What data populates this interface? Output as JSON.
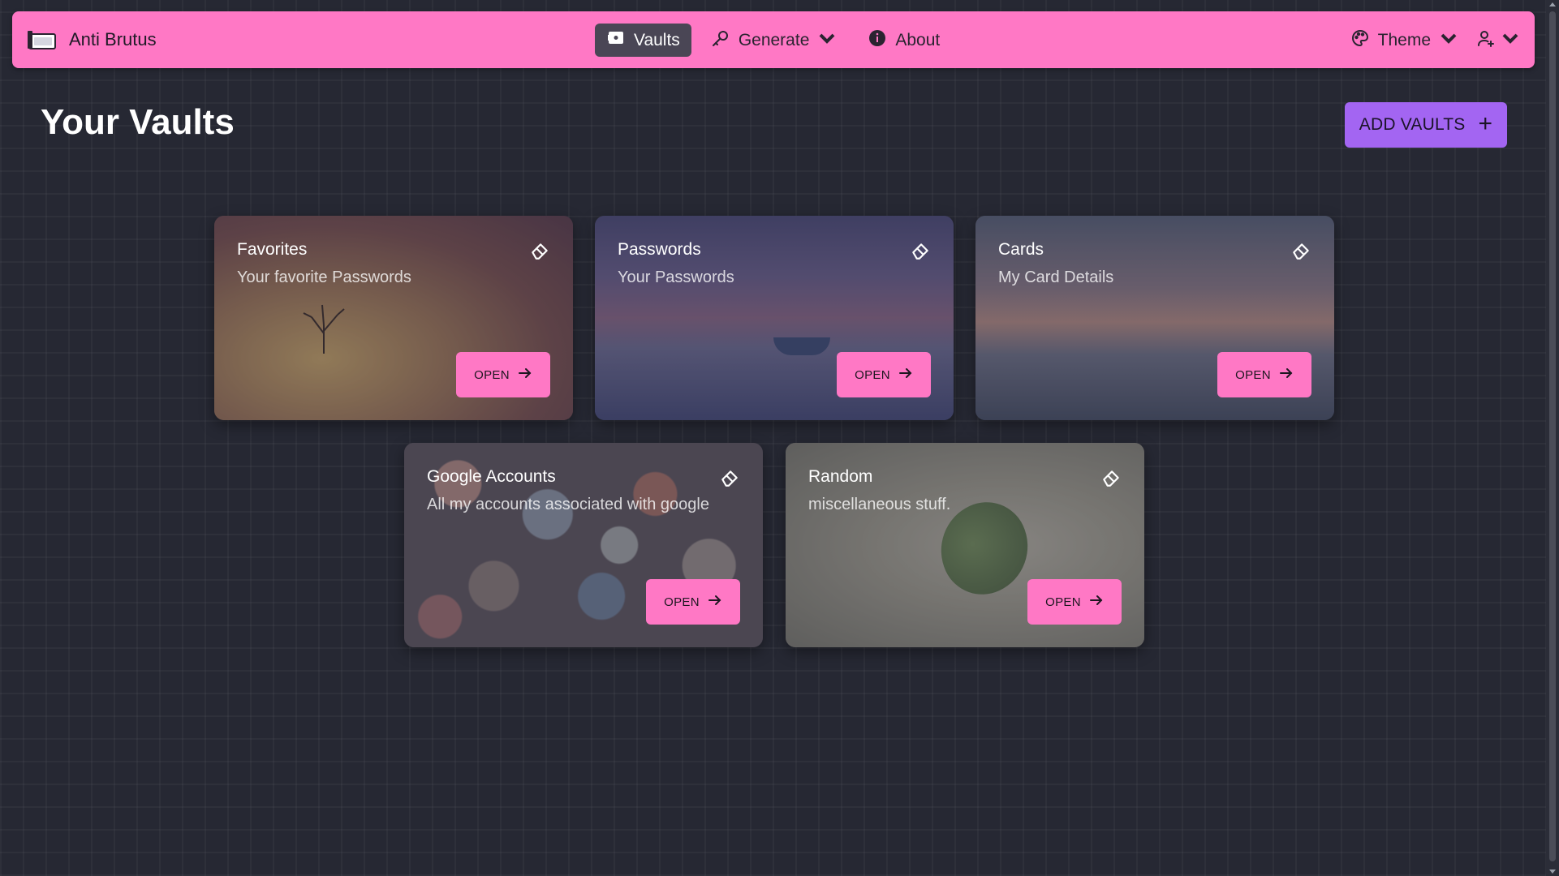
{
  "app": {
    "brand": "Anti Brutus"
  },
  "nav": {
    "vaults": "Vaults",
    "generate": "Generate",
    "about": "About",
    "theme": "Theme"
  },
  "page": {
    "title": "Your Vaults",
    "add_button": "ADD VAULTS",
    "add_icon": "+"
  },
  "cards": [
    {
      "title": "Favorites",
      "subtitle": "Your favorite Passwords",
      "open": "OPEN"
    },
    {
      "title": "Passwords",
      "subtitle": "Your Passwords",
      "open": "OPEN"
    },
    {
      "title": "Cards",
      "subtitle": "My Card Details",
      "open": "OPEN"
    },
    {
      "title": "Google Accounts",
      "subtitle": "All my accounts associated with google",
      "open": "OPEN"
    },
    {
      "title": "Random",
      "subtitle": "miscellaneous stuff.",
      "open": "OPEN"
    }
  ],
  "colors": {
    "navbar": "#ff78c5",
    "accent_button": "#a365f2",
    "background": "#262833"
  }
}
